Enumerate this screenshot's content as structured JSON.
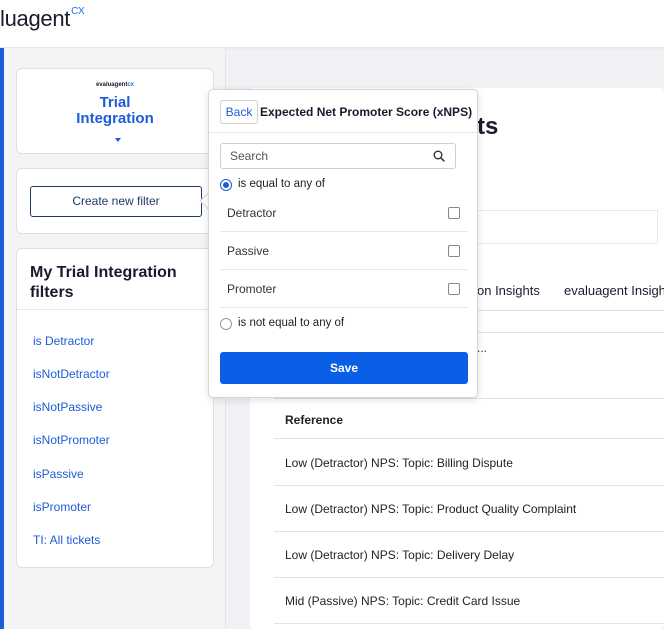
{
  "header": {
    "logo_text": "luagent",
    "logo_suffix": "CX"
  },
  "sidebar": {
    "brand_mini_prefix": "evaluagent",
    "brand_mini_suffix": "cx",
    "brand_line1": "Trial",
    "brand_line2": "Integration",
    "create_filter_label": "Create new filter",
    "filters_title": "My Trial Integration filters",
    "filters": [
      {
        "label": "is Detractor"
      },
      {
        "label": "isNotDetractor"
      },
      {
        "label": "isNotPassive"
      },
      {
        "label": "isNotPromoter"
      },
      {
        "label": "isPassive"
      },
      {
        "label": "isPromoter"
      },
      {
        "label": "TI: All tickets"
      }
    ]
  },
  "main": {
    "heading_fragment": "ts",
    "tabs": [
      {
        "label": "on Insights"
      },
      {
        "label": "evaluagent Insigh"
      }
    ],
    "ellipsis": "...",
    "table": {
      "header": "Reference",
      "rows": [
        {
          "reference": "Low (Detractor) NPS: Topic: Billing Dispute"
        },
        {
          "reference": "Low (Detractor) NPS: Topic: Product Quality Complaint"
        },
        {
          "reference": "Low (Detractor) NPS: Topic: Delivery Delay"
        },
        {
          "reference": "Mid (Passive) NPS: Topic: Credit Card Issue"
        }
      ]
    }
  },
  "popover": {
    "back_label": "Back",
    "title": "Expected Net Promoter Score (xNPS)",
    "search_placeholder": "Search",
    "mode_equal_label": "is equal to any of",
    "mode_not_equal_label": "is not equal to any of",
    "selected_mode": "equal",
    "options": [
      {
        "label": "Detractor",
        "checked": false
      },
      {
        "label": "Passive",
        "checked": false
      },
      {
        "label": "Promoter",
        "checked": false
      }
    ],
    "save_label": "Save"
  }
}
